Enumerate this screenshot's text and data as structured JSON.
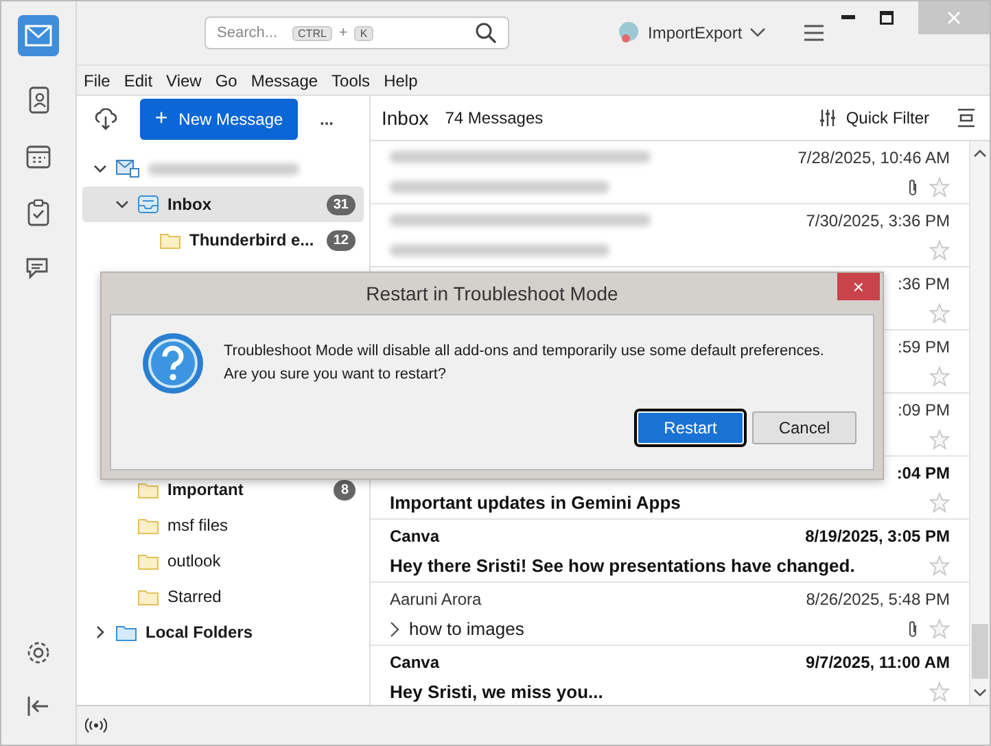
{
  "search": {
    "placeholder": "Search...",
    "keys": [
      "CTRL",
      "+",
      "K"
    ]
  },
  "account_switch": {
    "label": "ImportExport"
  },
  "menu": [
    "File",
    "Edit",
    "View",
    "Go",
    "Message",
    "Tools",
    "Help"
  ],
  "new_message": {
    "icon": "+",
    "label": "New Message"
  },
  "more_button": "...",
  "folders": [
    {
      "kind": "account",
      "expanded": true,
      "selected": false,
      "children": [
        {
          "label": "Inbox",
          "kind": "inbox",
          "expanded": true,
          "bold": true,
          "count": "31",
          "selected": true,
          "children": [
            {
              "label": "Thunderbird e...",
              "kind": "folder",
              "bold": true,
              "count": "12",
              "selected": false
            }
          ]
        },
        {
          "label": "Important",
          "kind": "folder",
          "bold": true,
          "count": "8",
          "selected": false,
          "hidden_above": true
        },
        {
          "label": "msf files",
          "kind": "folder",
          "bold": false,
          "selected": false
        },
        {
          "label": "outlook",
          "kind": "folder",
          "bold": false,
          "selected": false
        },
        {
          "label": "Starred",
          "kind": "folder",
          "bold": false,
          "selected": false
        }
      ]
    },
    {
      "label": "Local Folders",
      "kind": "local",
      "expanded": false,
      "bold": true,
      "selected": false
    }
  ],
  "list_header": {
    "folder": "Inbox",
    "count": "74 Messages",
    "quick_filter": "Quick Filter"
  },
  "messages": [
    {
      "kind": "redacted",
      "date": "7/28/2025, 10:46 AM",
      "unread": false,
      "attachment": true
    },
    {
      "kind": "redacted",
      "date": "7/30/2025, 3:36 PM",
      "unread": false
    },
    {
      "kind": "covered",
      "date": ":36 PM",
      "unread": false
    },
    {
      "kind": "covered",
      "date": ":59 PM",
      "unread": false
    },
    {
      "kind": "covered",
      "date": ":09 PM",
      "unread": false
    },
    {
      "kind": "plain",
      "subject": "Important updates in Gemini Apps",
      "date": ":04 PM",
      "unread": true
    },
    {
      "kind": "plain",
      "sender": "Canva",
      "subject": "Hey there Sristi! See how presentations have changed.",
      "date": "8/19/2025, 3:05 PM",
      "unread": true
    },
    {
      "kind": "plain",
      "sender": "Aaruni Arora",
      "subject": "how to images",
      "date": "8/26/2025, 5:48 PM",
      "unread": false,
      "attachment": true,
      "thread": true
    },
    {
      "kind": "plain",
      "sender": "Canva",
      "subject": "Hey Sristi, we miss you...",
      "date": "9/7/2025, 11:00 AM",
      "unread": true
    }
  ],
  "dialog": {
    "title": "Restart in Troubleshoot Mode",
    "close": "×",
    "message": "Troubleshoot Mode will disable all add-ons and temporarily use some default preferences.\nAre you sure you want to restart?",
    "buttons": [
      {
        "label": "Restart",
        "selected": true
      },
      {
        "label": "Cancel",
        "selected": false
      }
    ]
  }
}
